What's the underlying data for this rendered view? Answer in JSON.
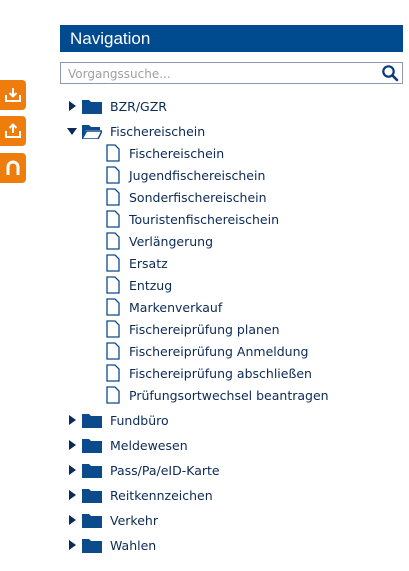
{
  "side_buttons": [
    {
      "icon": "download-icon"
    },
    {
      "icon": "upload-icon"
    },
    {
      "icon": "handle-icon"
    }
  ],
  "navigation": {
    "title": "Navigation",
    "search": {
      "placeholder": "Vorgangssuche...",
      "value": "",
      "icon": "search-icon"
    },
    "colors": {
      "header_bg": "#004a8f",
      "accent": "#ee7d0e",
      "text": "#0b2a55"
    },
    "tree": [
      {
        "label": "BZR/GZR",
        "expanded": false
      },
      {
        "label": "Fischereischein",
        "expanded": true,
        "children": [
          "Fischereischein",
          "Jugendfischereischein",
          "Sonderfischereischein",
          "Touristenfischereischein",
          "Verlängerung",
          "Ersatz",
          "Entzug",
          "Markenverkauf",
          "Fischereiprüfung planen",
          "Fischereiprüfung Anmeldung",
          "Fischereiprüfung abschließen",
          "Prüfungsortwechsel beantragen"
        ]
      },
      {
        "label": "Fundbüro",
        "expanded": false
      },
      {
        "label": "Meldewesen",
        "expanded": false
      },
      {
        "label": "Pass/Pa/eID-Karte",
        "expanded": false
      },
      {
        "label": "Reitkennzeichen",
        "expanded": false
      },
      {
        "label": "Verkehr",
        "expanded": false
      },
      {
        "label": "Wahlen",
        "expanded": false
      }
    ]
  }
}
